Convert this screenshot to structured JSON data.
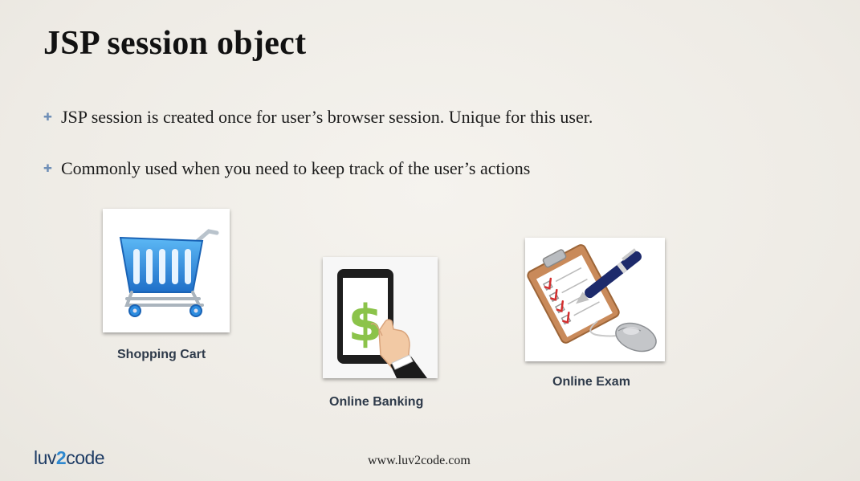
{
  "slide": {
    "title": "JSP session object",
    "bullets": [
      "JSP session is created once for user’s browser session. Unique for this user.",
      "Commonly used when you need to keep track of the user’s actions"
    ],
    "examples": [
      {
        "label": "Shopping Cart",
        "icon": "shopping-cart-icon"
      },
      {
        "label": "Online Banking",
        "icon": "tablet-dollar-icon"
      },
      {
        "label": "Online Exam",
        "icon": "clipboard-pen-mouse-icon"
      }
    ],
    "footer_url": "www.luv2code.com",
    "logo": {
      "part1": "luv",
      "part2": "2",
      "part3": "code"
    }
  },
  "colors": {
    "bullet_mark": "#6f8fb7",
    "cart_blue": "#2d8de0",
    "dollar_green": "#8bc34a",
    "logo_navy": "#1d3b64",
    "logo_blue": "#2e88cf"
  }
}
